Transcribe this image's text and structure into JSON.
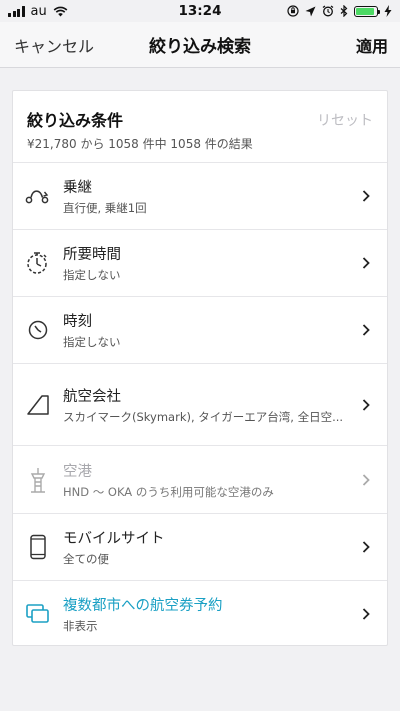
{
  "status_bar": {
    "carrier": "au",
    "time": "13:24"
  },
  "nav": {
    "cancel_label": "キャンセル",
    "title": "絞り込み検索",
    "apply_label": "適用"
  },
  "card": {
    "title": "絞り込み条件",
    "summary": "¥21,780 から 1058 件中 1058 件の結果",
    "reset_label": "リセット"
  },
  "filters": [
    {
      "title": "乗継",
      "subtitle": "直行便, 乗継1回",
      "icon": "connection-icon"
    },
    {
      "title": "所要時間",
      "subtitle": "指定しない",
      "icon": "stopwatch-icon"
    },
    {
      "title": "時刻",
      "subtitle": "指定しない",
      "icon": "clock-icon"
    },
    {
      "title": "航空会社",
      "subtitle": "スカイマーク(Skymark), タイガーエア台湾, 全日空...",
      "icon": "airline-tail-icon"
    },
    {
      "title": "空港",
      "subtitle": "HND 〜 OKA のうち利用可能な空港のみ",
      "icon": "airport-tower-icon"
    },
    {
      "title": "モバイルサイト",
      "subtitle": "全ての便",
      "icon": "mobile-phone-icon"
    },
    {
      "title": "複数都市への航空券予約",
      "subtitle": "非表示",
      "icon": "multi-city-icon"
    }
  ],
  "colors": {
    "accent": "#1ba0c4",
    "battery": "#4cd964",
    "background": "#f1f1f3"
  }
}
